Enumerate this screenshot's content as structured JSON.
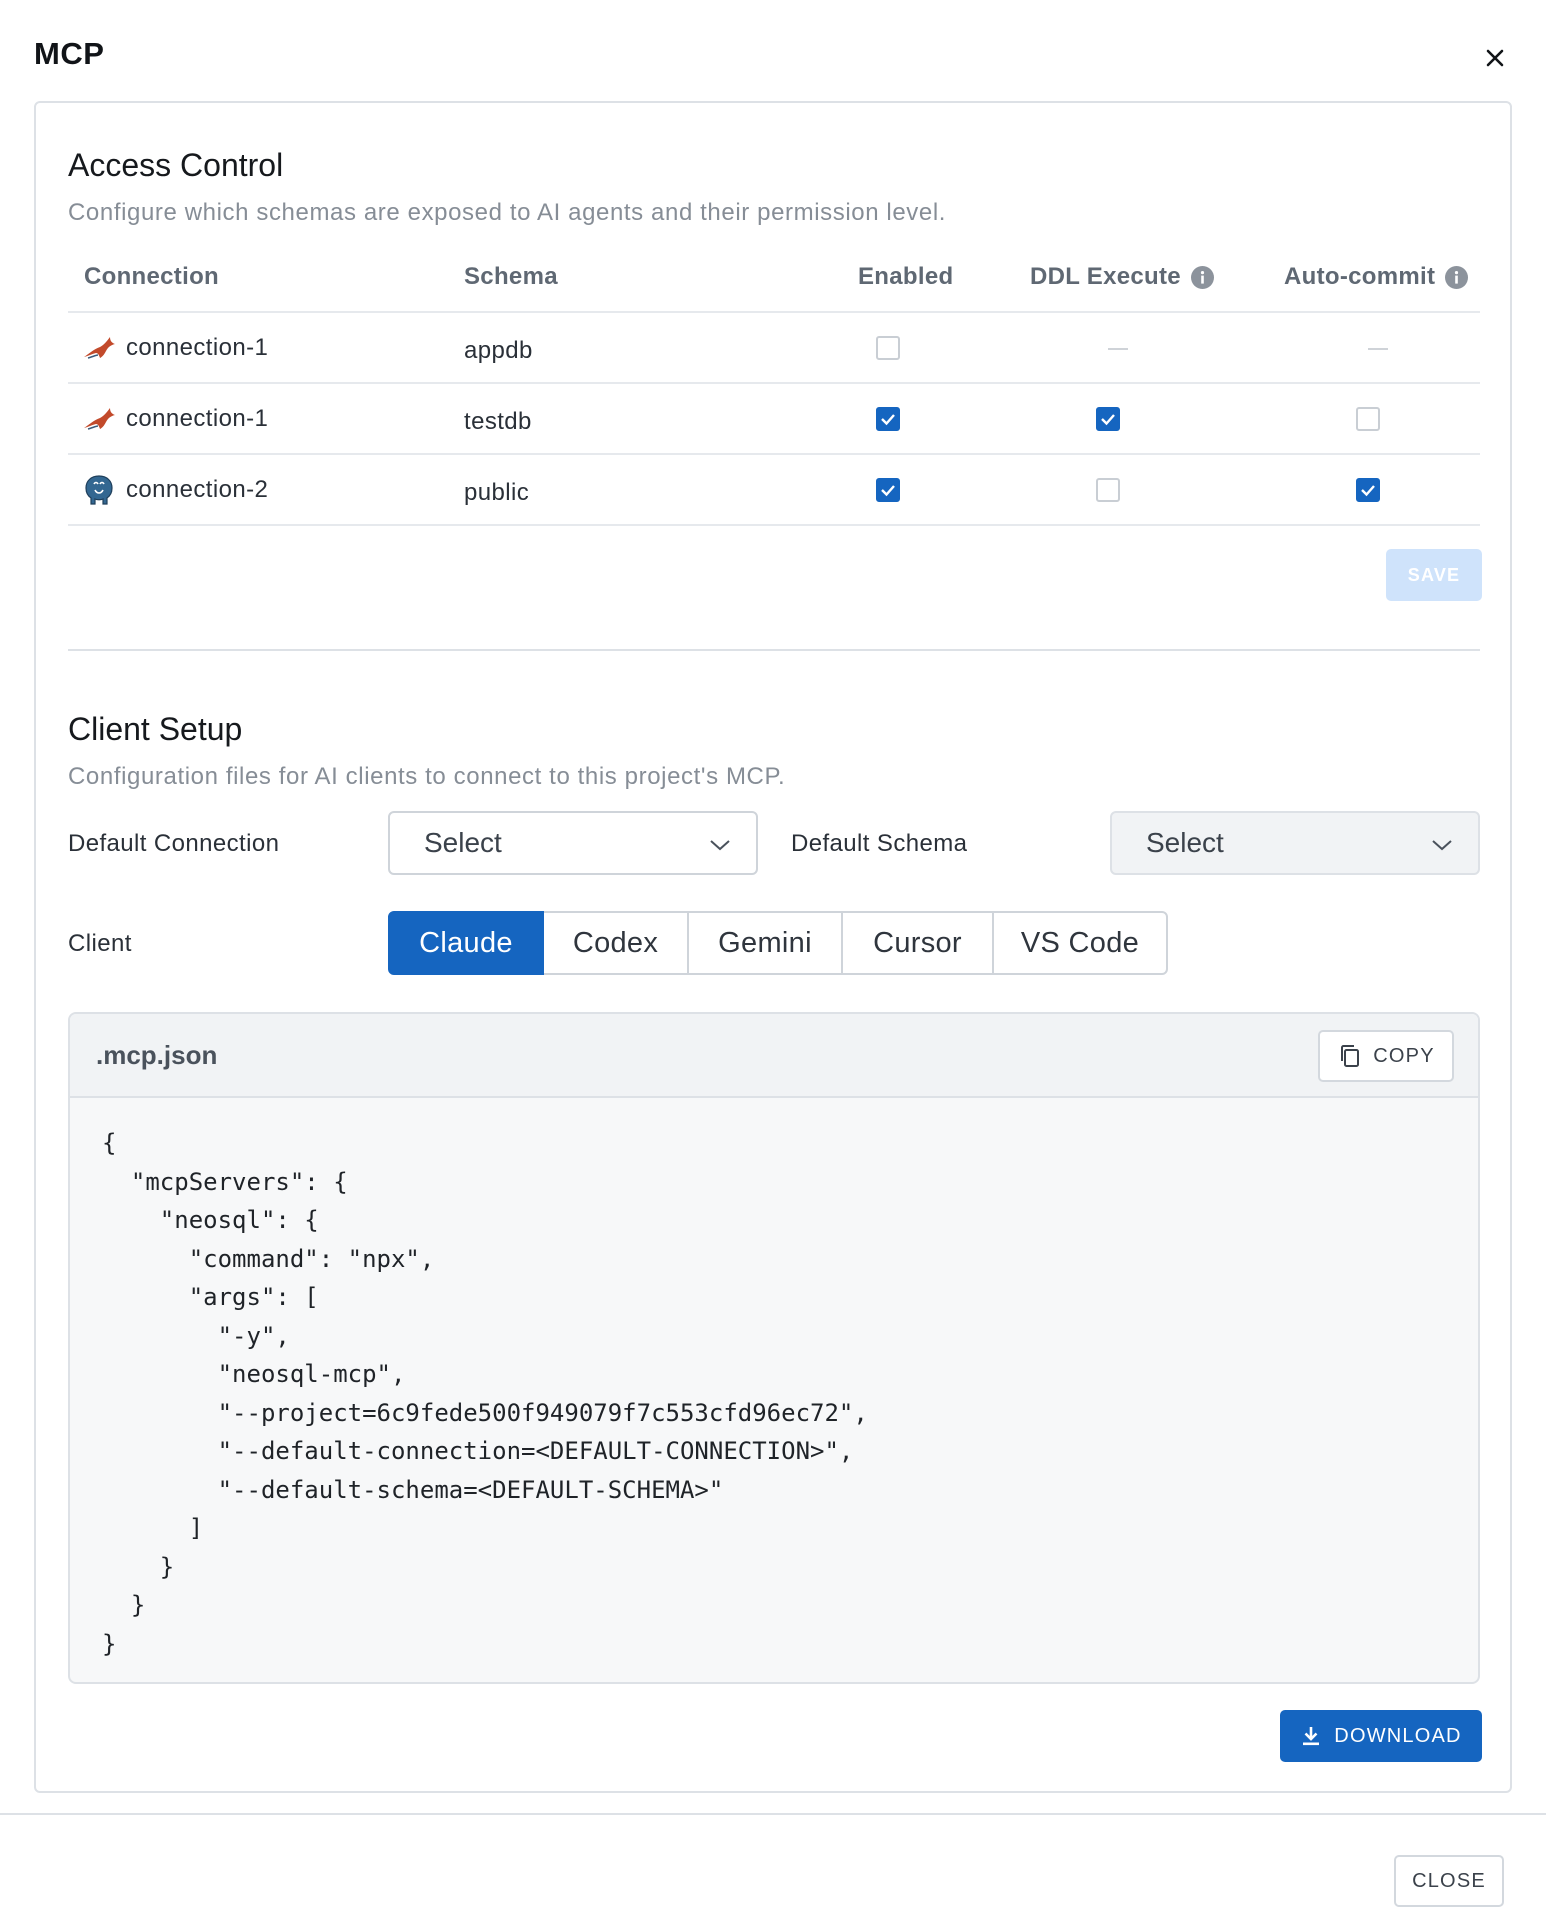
{
  "dialog": {
    "title": "MCP",
    "close_label": "CLOSE"
  },
  "access_control": {
    "title": "Access Control",
    "description": "Configure which schemas are exposed to AI agents and their permission level.",
    "columns": {
      "connection": "Connection",
      "schema": "Schema",
      "enabled": "Enabled",
      "ddl_execute": "DDL Execute",
      "auto_commit": "Auto-commit"
    },
    "rows": [
      {
        "connection": "connection-1",
        "db_icon": "mysql-dolphin-icon",
        "schema": "appdb",
        "enabled": false,
        "ddl_execute": null,
        "auto_commit": null
      },
      {
        "connection": "connection-1",
        "db_icon": "mysql-dolphin-icon",
        "schema": "testdb",
        "enabled": true,
        "ddl_execute": true,
        "auto_commit": false
      },
      {
        "connection": "connection-2",
        "db_icon": "postgresql-elephant-icon",
        "schema": "public",
        "enabled": true,
        "ddl_execute": false,
        "auto_commit": true
      }
    ],
    "save_label": "SAVE"
  },
  "client_setup": {
    "title": "Client Setup",
    "description": "Configuration files for AI clients to connect to this project's MCP.",
    "default_connection_label": "Default Connection",
    "default_connection_value": "Select",
    "default_schema_label": "Default Schema",
    "default_schema_value": "Select",
    "client_label": "Client",
    "clients": [
      "Claude",
      "Codex",
      "Gemini",
      "Cursor",
      "VS Code"
    ],
    "active_client": "Claude",
    "file_name": ".mcp.json",
    "copy_label": "COPY",
    "code": "{\n  \"mcpServers\": {\n    \"neosql\": {\n      \"command\": \"npx\",\n      \"args\": [\n        \"-y\",\n        \"neosql-mcp\",\n        \"--project=6c9fede500f949079f7c553cfd96ec72\",\n        \"--default-connection=<DEFAULT-CONNECTION>\",\n        \"--default-schema=<DEFAULT-SCHEMA>\"\n      ]\n    }\n  }\n}",
    "download_label": "DOWNLOAD"
  },
  "colors": {
    "accent": "#1565c0",
    "save_disabled": "#cfe3fb",
    "border": "#dde1e6"
  }
}
